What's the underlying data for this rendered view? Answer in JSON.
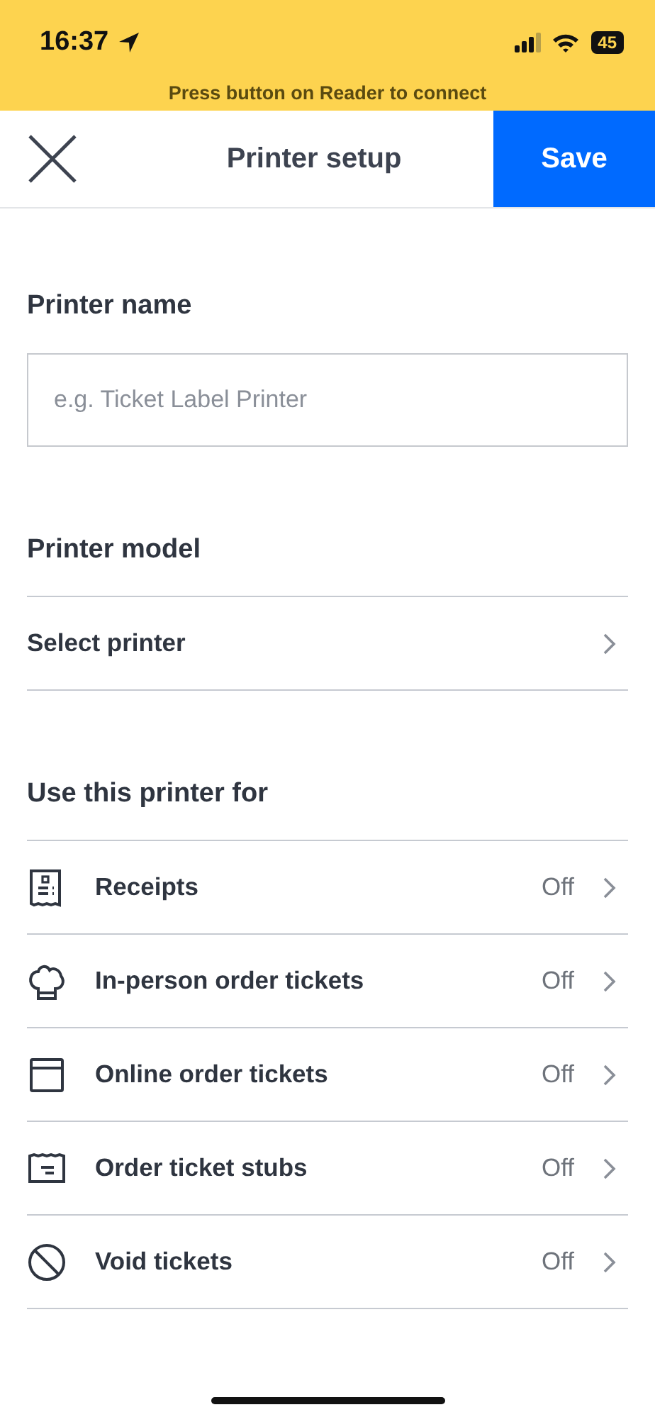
{
  "status_bar": {
    "time": "16:37",
    "battery": "45"
  },
  "banner": {
    "text": "Press button on Reader to connect"
  },
  "header": {
    "title": "Printer setup",
    "save": "Save"
  },
  "printer_name": {
    "label": "Printer name",
    "placeholder": "e.g. Ticket Label Printer"
  },
  "printer_model": {
    "label": "Printer model",
    "value": "Select printer"
  },
  "use_for": {
    "label": "Use this printer for",
    "items": [
      {
        "kind": "receipt",
        "label": "Receipts",
        "value": "Off"
      },
      {
        "kind": "chef",
        "label": "In-person order tickets",
        "value": "Off"
      },
      {
        "kind": "window",
        "label": "Online order tickets",
        "value": "Off"
      },
      {
        "kind": "stub",
        "label": "Order ticket stubs",
        "value": "Off"
      },
      {
        "kind": "void",
        "label": "Void tickets",
        "value": "Off"
      }
    ]
  }
}
